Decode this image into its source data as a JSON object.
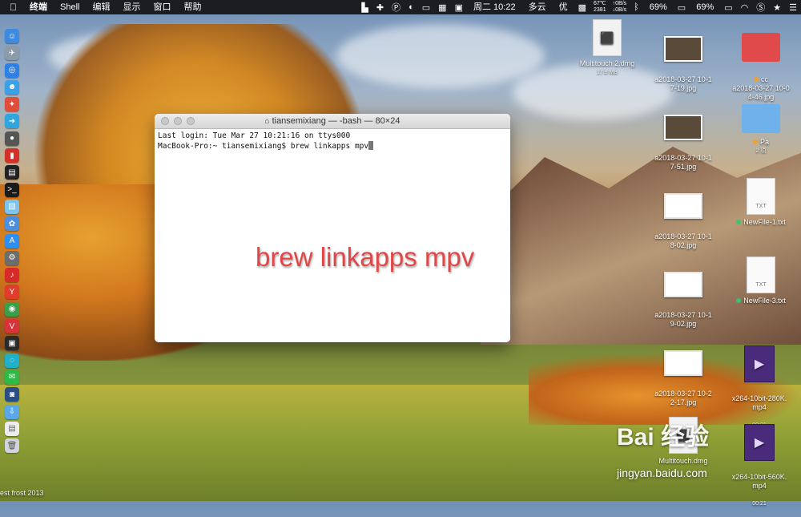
{
  "menubar": {
    "apple_icon": "apple-icon",
    "app_name": "终端",
    "menus": [
      "Shell",
      "编辑",
      "显示",
      "窗口",
      "帮助"
    ],
    "status": {
      "temp": "67℃",
      "temp_sub": "2381",
      "net_up": "↑0B/s",
      "net_down": "↓0B/s",
      "battery1": "69%",
      "battery2": "69%",
      "datetime": "周二 10:22",
      "weather": "多云",
      "you": "优"
    }
  },
  "terminal": {
    "title": "tiansemixiang — -bash — 80×24",
    "line1": "Last login: Tue Mar 27 10:21:16 on ttys000",
    "line2": "MacBook-Pro:~ tiansemixiang$ brew linkapps mpv",
    "overlay": "brew linkapps mpv"
  },
  "desktop": [
    {
      "label": "Multitouch 2.dmg",
      "sub": "17.8 MB"
    },
    {
      "label": "a2018-03-27 10-1\n7-19.jpg"
    },
    {
      "label": "cc\na2018-03-27 10-0\n4-46.jpg"
    },
    {
      "label": "a2018-03-27 10-1\n7-51.jpg"
    },
    {
      "label": "Pa",
      "sub": "2 项"
    },
    {
      "label": "a2018-03-27 10-1\n8-02.jpg"
    },
    {
      "label": "NewFile-1.txt"
    },
    {
      "label": "a2018-03-27 10-1\n9-02.jpg"
    },
    {
      "label": "NewFile-3.txt"
    },
    {
      "label": "a2018-03-27 10-2\n2-17.jpg"
    },
    {
      "label": "x264-10bit-280K.\nmp4",
      "sub": "00:21"
    },
    {
      "label": "Multitouch.dmg"
    },
    {
      "label": "x264-10bit-560K.\nmp4",
      "sub": "00:21"
    }
  ],
  "txt_badge": "TXT",
  "corner_text": "est frost 2013",
  "watermark": "Bai 经验",
  "watermark_url": "jingyan.baidu.com",
  "colors": {
    "overlay_red": "#e04848",
    "dot_orange": "#f0a030",
    "dot_green": "#3cc46a"
  }
}
